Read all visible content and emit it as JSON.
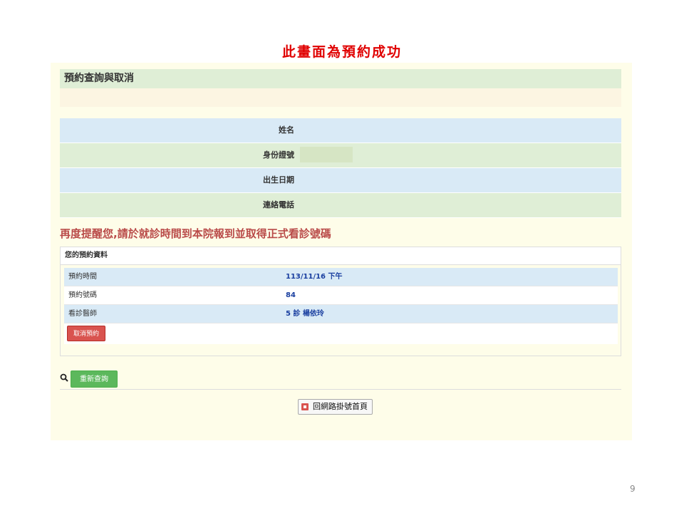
{
  "slide": {
    "title": "此畫面為預約成功",
    "page_number": "9"
  },
  "section": {
    "header": "預約查詢與取消"
  },
  "patient_form": {
    "fields": [
      {
        "label": "姓名",
        "value": ""
      },
      {
        "label": "身份證號",
        "value": ""
      },
      {
        "label": "出生日期",
        "value": ""
      },
      {
        "label": "連絡電話",
        "value": ""
      }
    ]
  },
  "reminder": "再度提醒您,請於就診時間到本院報到並取得正式看診號碼",
  "booking": {
    "title": "您的預約資料",
    "rows": [
      {
        "label": "預約時間",
        "value": "113/11/16 下午"
      },
      {
        "label": "預約號碼",
        "value": "84"
      },
      {
        "label": "看診醫師",
        "value": "5 診 楊依玲"
      }
    ],
    "cancel_label": "取消預約"
  },
  "actions": {
    "requery_label": "重新查詢",
    "home_label": "回網路掛號首頁"
  },
  "colors": {
    "title_red": "#e00000",
    "reminder_red": "#b94a48",
    "panel_bg": "#fefde9",
    "row_blue": "#d9eaf6",
    "row_green": "#dfeed6",
    "value_blue": "#1a3fa0",
    "cancel_button": "#d9534f",
    "requery_button": "#5cb85c"
  },
  "icons": {
    "search": "search-icon",
    "home": "home-icon"
  }
}
